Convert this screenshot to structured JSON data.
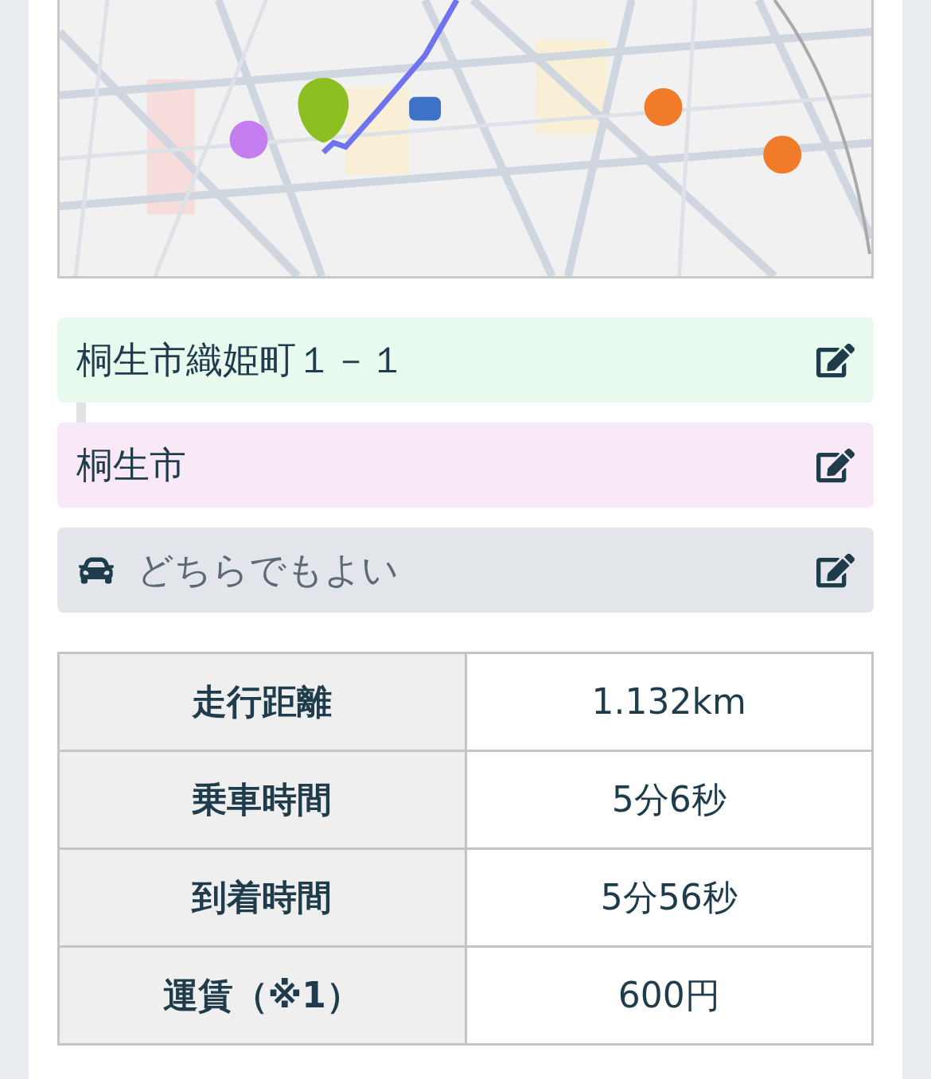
{
  "fields": [
    {
      "kind": "origin",
      "text": "桐生市織姫町１－１"
    },
    {
      "kind": "destination",
      "text": "桐生市"
    },
    {
      "kind": "vehicle",
      "text": "どちらでもよい"
    }
  ],
  "summary": {
    "rows": [
      {
        "label": "走行距離",
        "value": "1.132km"
      },
      {
        "label": "乗車時間",
        "value": "5分6秒"
      },
      {
        "label": "到着時間",
        "value": "5分56秒"
      },
      {
        "label": "運賃（※1）",
        "value": "600円"
      }
    ]
  }
}
